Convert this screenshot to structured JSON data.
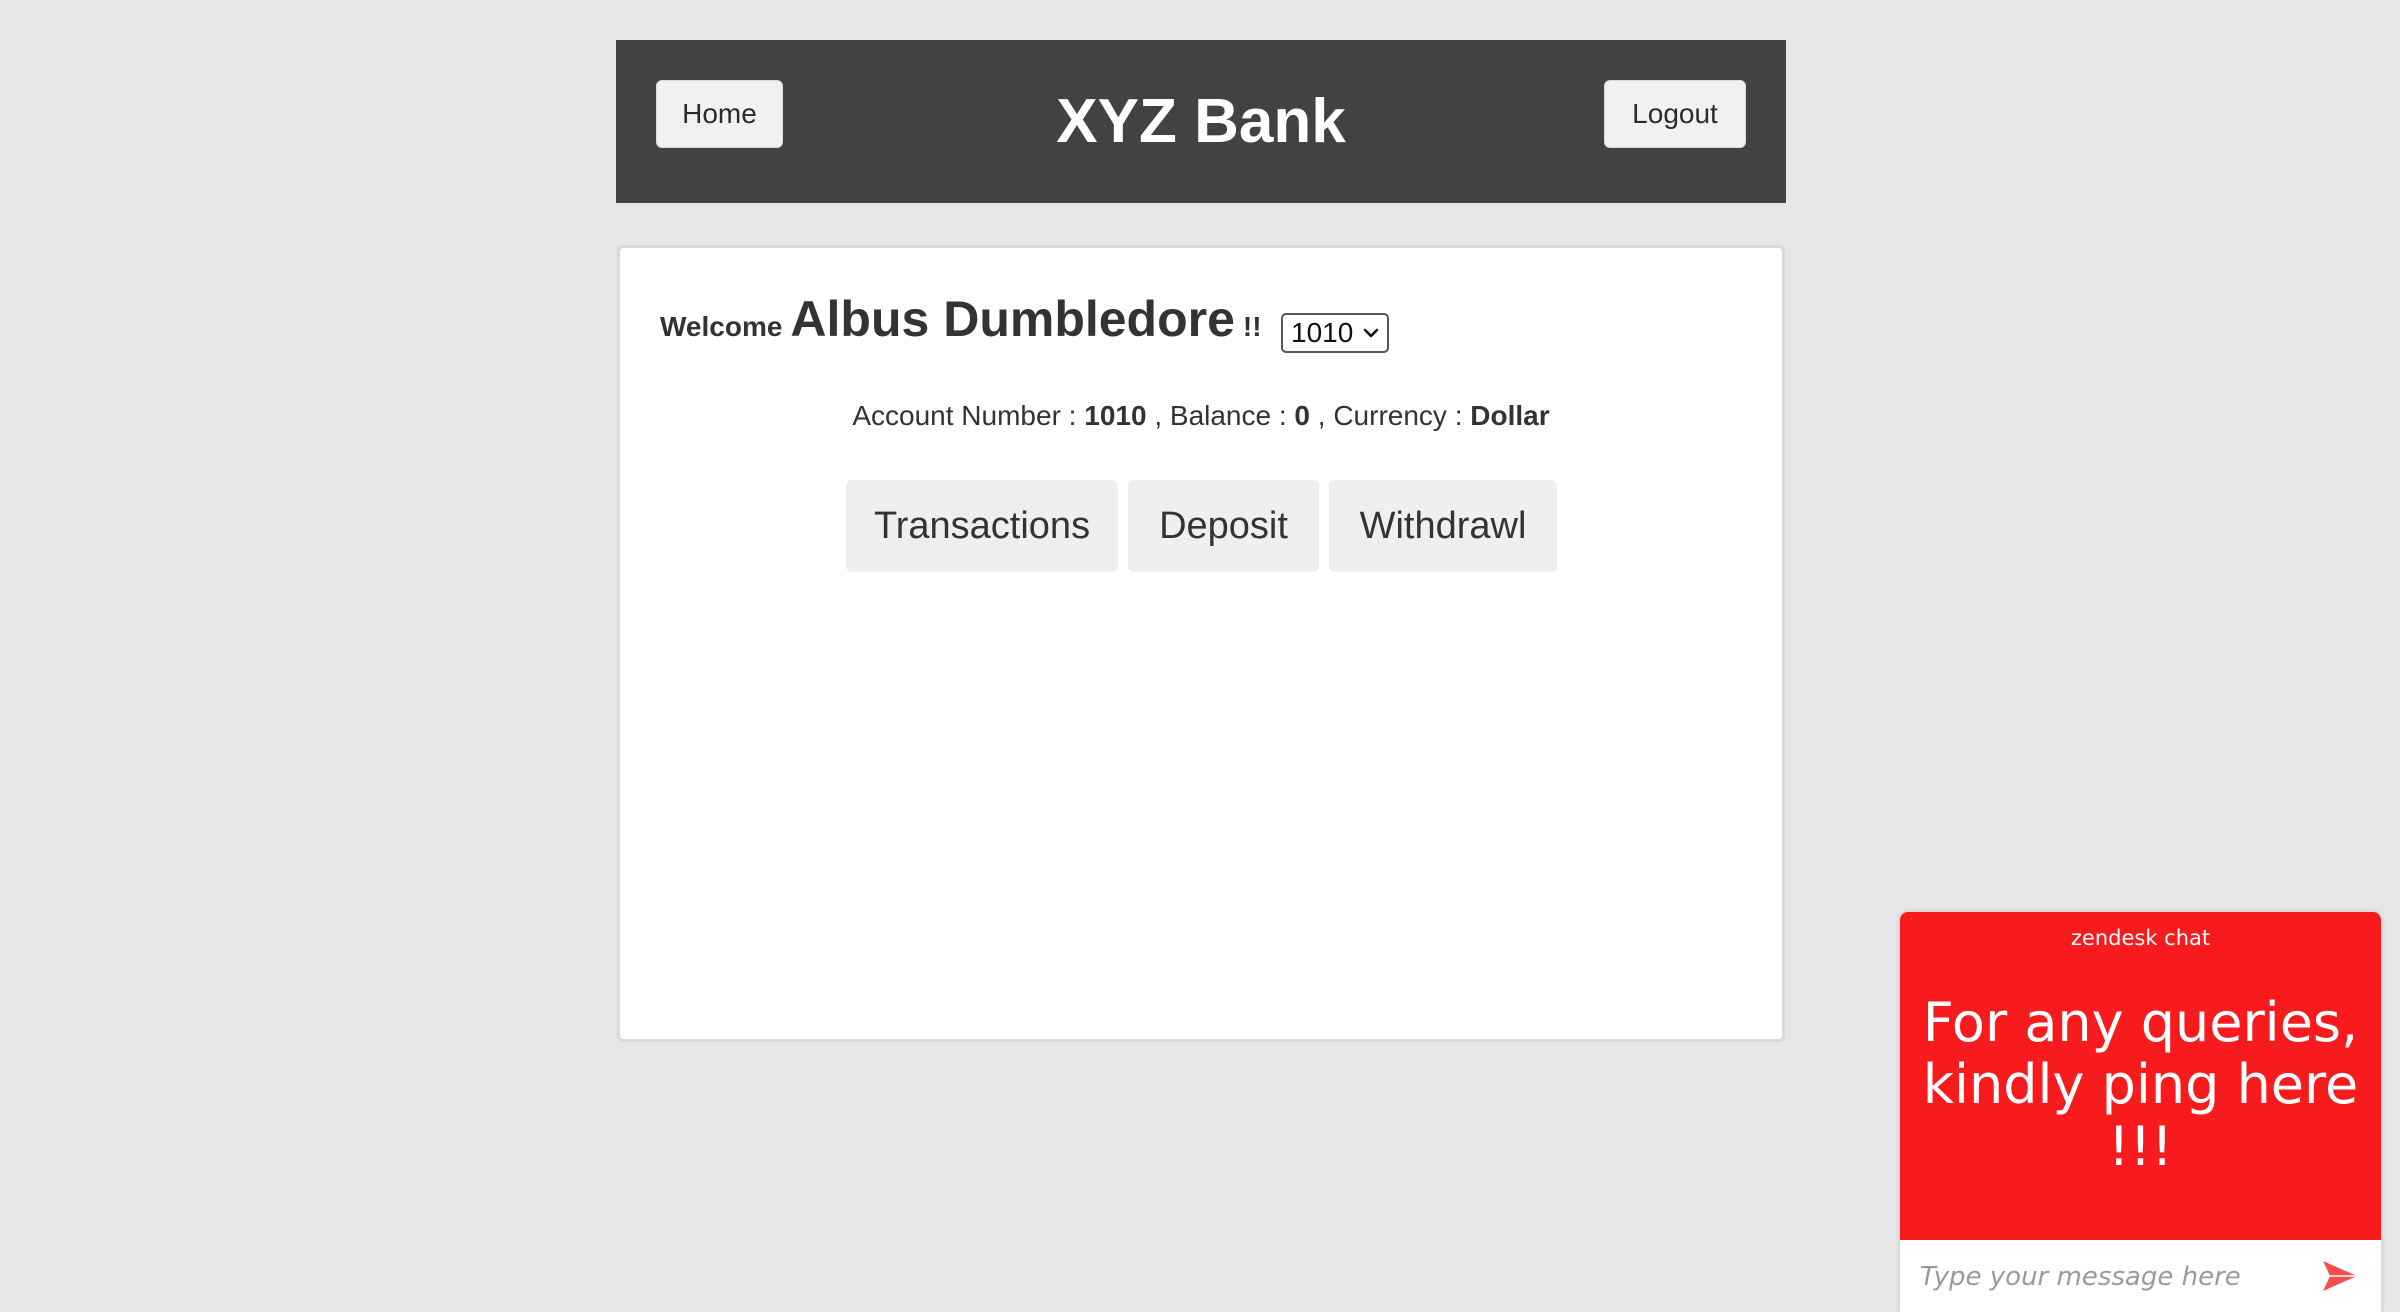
{
  "header": {
    "home_label": "Home",
    "title": "XYZ Bank",
    "logout_label": "Logout"
  },
  "customer": {
    "welcome_label": "Welcome",
    "name": "Albus Dumbledore",
    "exclaim": "!!",
    "selected_account": "1010"
  },
  "account_info": {
    "account_number_label": "Account Number :",
    "account_number": "1010",
    "balance_label": ", Balance :",
    "balance": "0",
    "currency_label": ", Currency :",
    "currency": "Dollar"
  },
  "tabs": [
    {
      "label": "Transactions"
    },
    {
      "label": "Deposit"
    },
    {
      "label": "Withdrawl"
    }
  ],
  "chat": {
    "brand": "zendesk chat",
    "message": "For any queries, kindly ping here !!!",
    "input_placeholder": "Type your message here",
    "send_icon": "send-icon"
  },
  "colors": {
    "page_bg": "#e6e6e6",
    "header_bg": "#424242",
    "chat_red": "#f71b1e",
    "button_bg": "#efefef"
  }
}
